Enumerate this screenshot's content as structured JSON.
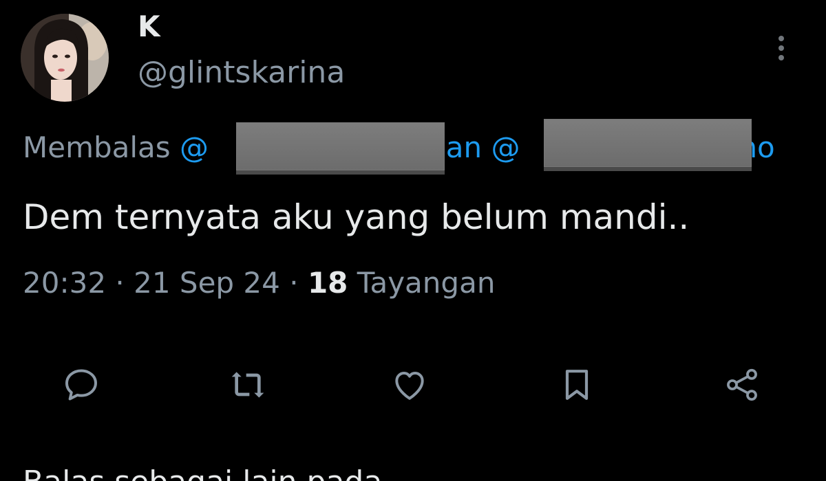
{
  "author": {
    "display_name": "K",
    "handle": "@glintskarina"
  },
  "reply_context": {
    "prefix": "Membalas",
    "mention_1_visible": "@",
    "conjunction": "dan",
    "mention_2_visible_start": "@",
    "mention_2_visible_end": "no"
  },
  "tweet": {
    "text": "Dem ternyata aku yang belum mandi.."
  },
  "meta": {
    "time": "20:32",
    "separator": "·",
    "date": "21 Sep 24",
    "views_count": "18",
    "views_label": "Tayangan"
  },
  "actions": {
    "icons": [
      "reply-icon",
      "repost-icon",
      "like-icon",
      "bookmark-icon",
      "share-icon"
    ]
  },
  "bottom_partial_text": "Balas sebagai lain pada",
  "colors": {
    "background": "#000000",
    "primary_text": "#e7e9ea",
    "secondary_text": "#8b98a5",
    "link": "#1d9bf0",
    "redaction": "#707070"
  }
}
